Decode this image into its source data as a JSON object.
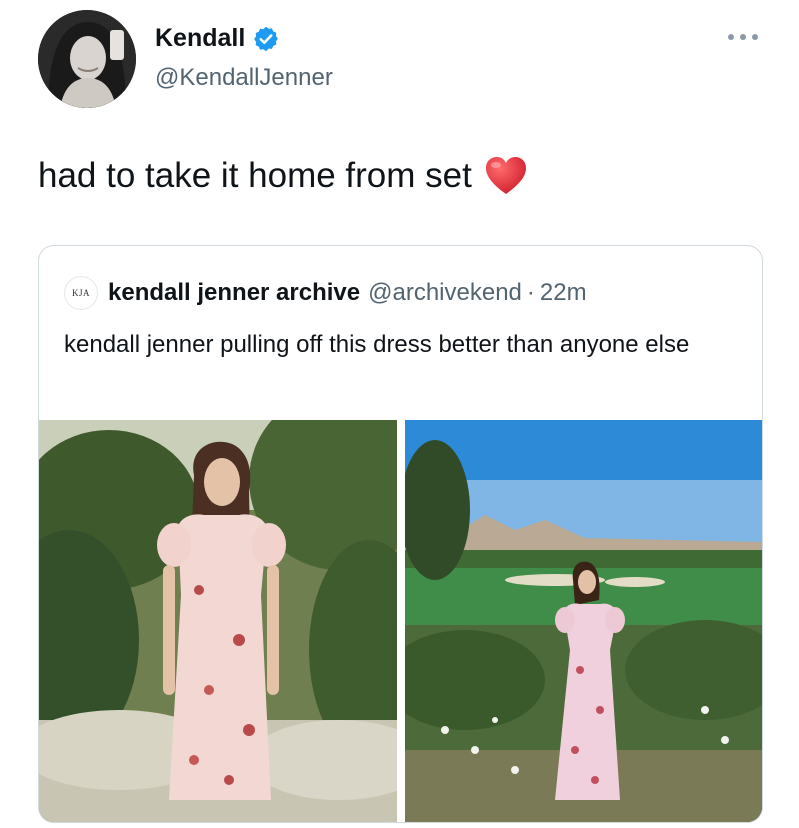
{
  "author": {
    "display_name": "Kendall",
    "handle": "@KendallJenner",
    "verified": true,
    "avatar_icon": "profile-photo"
  },
  "tweet": {
    "text": "had to take it home from set",
    "emoji": "red-heart-icon"
  },
  "quoted": {
    "avatar_text": "KJA",
    "display_name": "kendall jenner archive",
    "handle": "@archivekend",
    "separator": "·",
    "time": "22m",
    "text": "kendall jenner pulling off this dress better than anyone else",
    "photos": [
      "garden-photo",
      "golf-course-photo"
    ]
  },
  "colors": {
    "text": "#0f1419",
    "secondary": "#536471",
    "verified": "#1d9bf0",
    "border": "#cfd9de",
    "heart": "#e0245e"
  }
}
